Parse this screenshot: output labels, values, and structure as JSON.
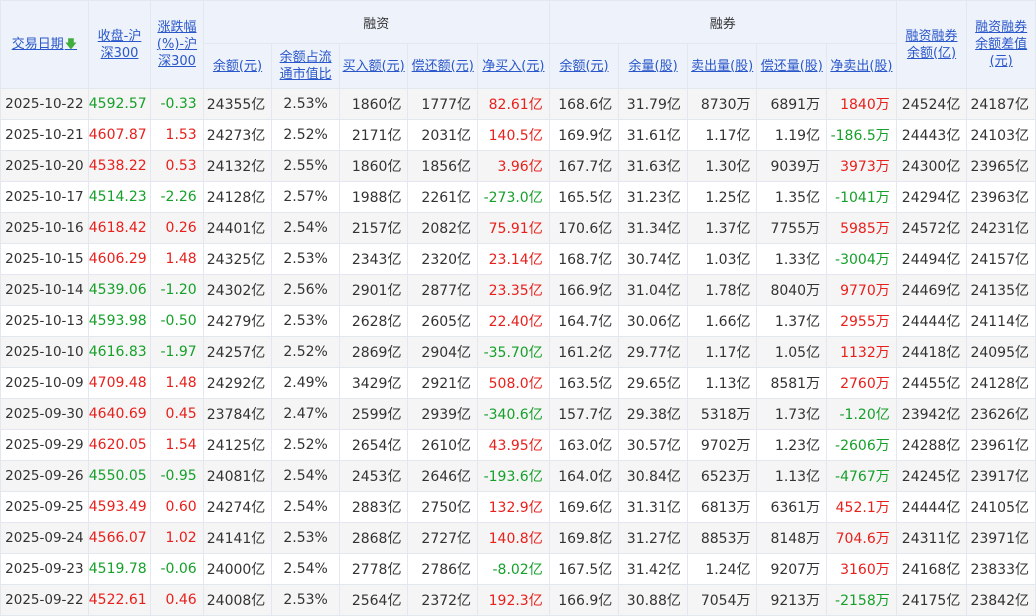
{
  "header": {
    "date": "交易日期",
    "close": [
      "收盘-沪",
      "深300"
    ],
    "change": [
      "涨跌幅",
      "(%)-沪",
      "深300"
    ],
    "margin_group": "融资",
    "short_group": "融券",
    "total": [
      "融资融券",
      "余额(亿)"
    ],
    "diff": [
      "融资融券",
      "余额差值",
      "(元)"
    ],
    "margin_cols": [
      {
        "label": [
          "余额(元)"
        ]
      },
      {
        "label": [
          "余额占流",
          "通市值比"
        ]
      },
      {
        "label": [
          "买入额(元)"
        ]
      },
      {
        "label": [
          "偿还额(元)"
        ]
      },
      {
        "label": [
          "净买入(元)"
        ]
      }
    ],
    "short_cols": [
      {
        "label": [
          "余额(元)"
        ]
      },
      {
        "label": [
          "余量(股)"
        ]
      },
      {
        "label": [
          "卖出量(股)"
        ]
      },
      {
        "label": [
          "偿还量(股)"
        ]
      },
      {
        "label": [
          "净卖出(股)"
        ]
      }
    ]
  },
  "colors": {
    "up": "#e8201c",
    "down": "#16a02a",
    "link": "#2a57c9",
    "header_bg": "#eef3fb",
    "alt_row": "#f5f5f5"
  },
  "rows": [
    [
      "2025-10-22",
      "4592.57",
      "-0.33",
      "24355亿",
      "2.53%",
      "1860亿",
      "1777亿",
      "82.61亿",
      "168.6亿",
      "31.79亿",
      "8730万",
      "6891万",
      "1840万",
      "24524亿",
      "24187亿"
    ],
    [
      "2025-10-21",
      "4607.87",
      "1.53",
      "24273亿",
      "2.52%",
      "2171亿",
      "2031亿",
      "140.5亿",
      "169.9亿",
      "31.61亿",
      "1.17亿",
      "1.19亿",
      "-186.5万",
      "24443亿",
      "24103亿"
    ],
    [
      "2025-10-20",
      "4538.22",
      "0.53",
      "24132亿",
      "2.55%",
      "1860亿",
      "1856亿",
      "3.96亿",
      "167.7亿",
      "31.63亿",
      "1.30亿",
      "9039万",
      "3973万",
      "24300亿",
      "23965亿"
    ],
    [
      "2025-10-17",
      "4514.23",
      "-2.26",
      "24128亿",
      "2.57%",
      "1988亿",
      "2261亿",
      "-273.0亿",
      "165.5亿",
      "31.23亿",
      "1.25亿",
      "1.35亿",
      "-1041万",
      "24294亿",
      "23963亿"
    ],
    [
      "2025-10-16",
      "4618.42",
      "0.26",
      "24401亿",
      "2.54%",
      "2157亿",
      "2082亿",
      "75.91亿",
      "170.6亿",
      "31.34亿",
      "1.37亿",
      "7755万",
      "5985万",
      "24572亿",
      "24231亿"
    ],
    [
      "2025-10-15",
      "4606.29",
      "1.48",
      "24325亿",
      "2.53%",
      "2343亿",
      "2320亿",
      "23.14亿",
      "168.7亿",
      "30.74亿",
      "1.03亿",
      "1.33亿",
      "-3004万",
      "24494亿",
      "24157亿"
    ],
    [
      "2025-10-14",
      "4539.06",
      "-1.20",
      "24302亿",
      "2.56%",
      "2901亿",
      "2877亿",
      "23.35亿",
      "166.9亿",
      "31.04亿",
      "1.78亿",
      "8040万",
      "9770万",
      "24469亿",
      "24135亿"
    ],
    [
      "2025-10-13",
      "4593.98",
      "-0.50",
      "24279亿",
      "2.53%",
      "2628亿",
      "2605亿",
      "22.40亿",
      "164.7亿",
      "30.06亿",
      "1.66亿",
      "1.37亿",
      "2955万",
      "24444亿",
      "24114亿"
    ],
    [
      "2025-10-10",
      "4616.83",
      "-1.97",
      "24257亿",
      "2.52%",
      "2869亿",
      "2904亿",
      "-35.70亿",
      "161.2亿",
      "29.77亿",
      "1.17亿",
      "1.05亿",
      "1132万",
      "24418亿",
      "24095亿"
    ],
    [
      "2025-10-09",
      "4709.48",
      "1.48",
      "24292亿",
      "2.49%",
      "3429亿",
      "2921亿",
      "508.0亿",
      "163.5亿",
      "29.65亿",
      "1.13亿",
      "8581万",
      "2760万",
      "24455亿",
      "24128亿"
    ],
    [
      "2025-09-30",
      "4640.69",
      "0.45",
      "23784亿",
      "2.47%",
      "2599亿",
      "2939亿",
      "-340.6亿",
      "157.7亿",
      "29.38亿",
      "5318万",
      "1.73亿",
      "-1.20亿",
      "23942亿",
      "23626亿"
    ],
    [
      "2025-09-29",
      "4620.05",
      "1.54",
      "24125亿",
      "2.52%",
      "2654亿",
      "2610亿",
      "43.95亿",
      "163.0亿",
      "30.57亿",
      "9702万",
      "1.23亿",
      "-2606万",
      "24288亿",
      "23961亿"
    ],
    [
      "2025-09-26",
      "4550.05",
      "-0.95",
      "24081亿",
      "2.54%",
      "2453亿",
      "2646亿",
      "-193.6亿",
      "164.0亿",
      "30.84亿",
      "6523万",
      "1.13亿",
      "-4767万",
      "24245亿",
      "23917亿"
    ],
    [
      "2025-09-25",
      "4593.49",
      "0.60",
      "24274亿",
      "2.54%",
      "2883亿",
      "2750亿",
      "132.9亿",
      "169.6亿",
      "31.31亿",
      "6813万",
      "6361万",
      "452.1万",
      "24444亿",
      "24105亿"
    ],
    [
      "2025-09-24",
      "4566.07",
      "1.02",
      "24141亿",
      "2.53%",
      "2868亿",
      "2727亿",
      "140.8亿",
      "169.8亿",
      "31.27亿",
      "8853万",
      "8148万",
      "704.6万",
      "24311亿",
      "23971亿"
    ],
    [
      "2025-09-23",
      "4519.78",
      "-0.06",
      "24000亿",
      "2.54%",
      "2778亿",
      "2786亿",
      "-8.02亿",
      "167.5亿",
      "31.42亿",
      "1.24亿",
      "9207万",
      "3160万",
      "24168亿",
      "23833亿"
    ],
    [
      "2025-09-22",
      "4522.61",
      "0.46",
      "24008亿",
      "2.53%",
      "2564亿",
      "2372亿",
      "192.3亿",
      "166.9亿",
      "30.88亿",
      "7054万",
      "9213万",
      "-2158万",
      "24175亿",
      "23842亿"
    ]
  ]
}
